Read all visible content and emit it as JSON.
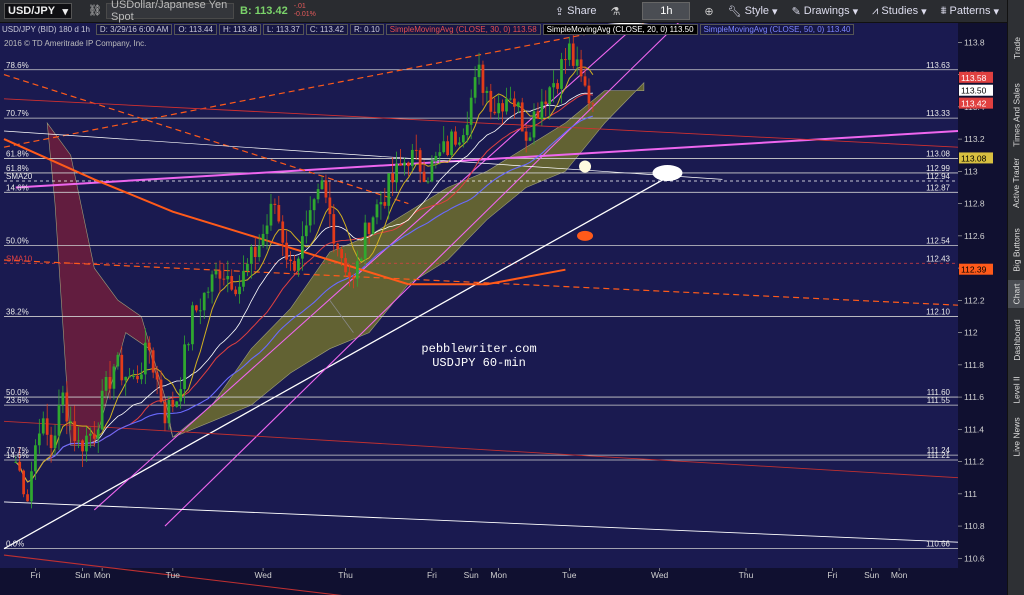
{
  "toolbar": {
    "symbol": "USD/JPY",
    "description": "USDollar/Japanese Yen Spot",
    "bid_label": "B:",
    "bid_value": "113.42",
    "change": "-.01",
    "change_pct": "-0.01%",
    "share": "Share",
    "timeframe": "1h",
    "style": "Style",
    "drawings": "Drawings",
    "studies": "Studies",
    "patterns": "Patterns"
  },
  "studybar": {
    "title": "USD/JPY (BID) 180 d 1h",
    "date": "D: 3/29/16 6:00 AM",
    "open": "O: 113.44",
    "high": "H: 113.48",
    "low": "L: 113.37",
    "close": "C: 113.42",
    "range": "R: 0.10",
    "sma30": "SimpleMovingAvg (CLOSE, 30, 0)",
    "sma30_val": "113.58",
    "sma20": "SimpleMovingAvg (CLOSE, 20, 0)",
    "sma20_val": "113.50",
    "sma50": "SimpleMovingAvg (CLOSE, 50, 0)",
    "sma50_val": "113.40"
  },
  "copyright": "2016 © TD Ameritrade IP Company, Inc.",
  "sidebar": [
    "Trade",
    "Times And Sales",
    "Active Trader",
    "Big Buttons",
    "Chart",
    "Dashboard",
    "Level II",
    "Live News"
  ],
  "colors": {
    "background": "#1a1a50",
    "cloud_bull": "#7a7a2a",
    "cloud_bear": "#7a1f3a",
    "up_candle": "#2fa82f",
    "down_candle": "#e23b1a",
    "fib": "#d0d0d0",
    "magenta": "#ee66ee",
    "orange": "#ff5a1a"
  },
  "chart_data": {
    "type": "candlestick",
    "symbol": "USD/JPY",
    "interval": "1h",
    "annotation": [
      "pebblewriter.com",
      "USDJPY 60-min"
    ],
    "ylim": [
      110.54,
      113.92
    ],
    "y_ticks": [
      110.6,
      110.8,
      111,
      111.2,
      111.4,
      111.6,
      111.8,
      112,
      112.2,
      112.4,
      112.6,
      112.8,
      113,
      113.2,
      113.4,
      113.6,
      113.8
    ],
    "x_ticks": [
      {
        "label": "Fri",
        "t": 5
      },
      {
        "label": "Sun",
        "t": 17
      },
      {
        "label": "Mon",
        "t": 22
      },
      {
        "label": "Tue",
        "t": 40
      },
      {
        "label": "Wed",
        "t": 63
      },
      {
        "label": "Thu",
        "t": 84
      },
      {
        "label": "Fri",
        "t": 106
      },
      {
        "label": "Sun",
        "t": 116
      },
      {
        "label": "Mon",
        "t": 123
      },
      {
        "label": "Tue",
        "t": 141
      },
      {
        "label": "Wed",
        "t": 164
      },
      {
        "label": "Thu",
        "t": 186
      },
      {
        "label": "Fri",
        "t": 208
      },
      {
        "label": "Sun",
        "t": 218
      },
      {
        "label": "Mon",
        "t": 225
      }
    ],
    "fib_levels": [
      {
        "label": "78.6%",
        "value": 113.63
      },
      {
        "label": "70.7%",
        "value": 113.33
      },
      {
        "label": "61.8%",
        "value": 113.08
      },
      {
        "label": "61.8%",
        "value": 112.99
      },
      {
        "label": "14.6%",
        "value": 112.87
      },
      {
        "label": "50.0%",
        "value": 112.54
      },
      {
        "label": "38.2%",
        "value": 112.1
      },
      {
        "label": "50.0%",
        "value": 111.6
      },
      {
        "label": "23.6%",
        "value": 111.55
      },
      {
        "label": "70.7%",
        "value": 111.24
      },
      {
        "label": "14.6%",
        "value": 111.21
      },
      {
        "label": "0.0%",
        "value": 110.66
      }
    ],
    "other_levels": [
      {
        "label": "SMA20",
        "value": 112.94
      },
      {
        "label": "SMA10",
        "value": 112.43
      }
    ],
    "price_tags": [
      {
        "value": "113.58",
        "kind": "sma30"
      },
      {
        "value": "113.50",
        "kind": "sma20"
      },
      {
        "value": "113.42",
        "kind": "last"
      },
      {
        "value": "113.08",
        "kind": "fib"
      },
      {
        "value": "112.39",
        "kind": "sma"
      }
    ],
    "right_labels": [
      "113.63",
      "113.33",
      "113.08",
      "112.99",
      "112.94",
      "112.87",
      "112.54",
      "112.43",
      "112.10",
      "111.60",
      "111.55",
      "111.24",
      "111.21",
      "110.66"
    ],
    "path_anchors": [
      {
        "t": 0,
        "p": 111.2
      },
      {
        "t": 3,
        "p": 111.0
      },
      {
        "t": 6,
        "p": 111.45
      },
      {
        "t": 9,
        "p": 111.3
      },
      {
        "t": 12,
        "p": 111.6
      },
      {
        "t": 16,
        "p": 111.3
      },
      {
        "t": 20,
        "p": 111.4
      },
      {
        "t": 25,
        "p": 111.8
      },
      {
        "t": 30,
        "p": 111.7
      },
      {
        "t": 34,
        "p": 111.9
      },
      {
        "t": 38,
        "p": 111.5
      },
      {
        "t": 41,
        "p": 111.6
      },
      {
        "t": 45,
        "p": 112.1
      },
      {
        "t": 52,
        "p": 112.4
      },
      {
        "t": 57,
        "p": 112.3
      },
      {
        "t": 62,
        "p": 112.55
      },
      {
        "t": 66,
        "p": 112.8
      },
      {
        "t": 70,
        "p": 112.4
      },
      {
        "t": 74,
        "p": 112.6
      },
      {
        "t": 78,
        "p": 112.9
      },
      {
        "t": 82,
        "p": 112.55
      },
      {
        "t": 86,
        "p": 112.3
      },
      {
        "t": 90,
        "p": 112.7
      },
      {
        "t": 95,
        "p": 112.9
      },
      {
        "t": 100,
        "p": 113.1
      },
      {
        "t": 105,
        "p": 113.0
      },
      {
        "t": 110,
        "p": 113.15
      },
      {
        "t": 114,
        "p": 113.3
      },
      {
        "t": 118,
        "p": 113.6
      },
      {
        "t": 122,
        "p": 113.4
      },
      {
        "t": 126,
        "p": 113.5
      },
      {
        "t": 130,
        "p": 113.25
      },
      {
        "t": 134,
        "p": 113.45
      },
      {
        "t": 138,
        "p": 113.6
      },
      {
        "t": 141,
        "p": 113.75
      },
      {
        "t": 144,
        "p": 113.55
      },
      {
        "t": 147,
        "p": 113.42
      }
    ]
  }
}
